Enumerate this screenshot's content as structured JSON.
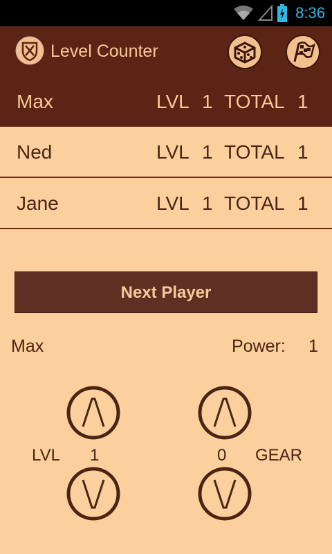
{
  "status_bar": {
    "time": "8:36",
    "icons": [
      "wifi-icon",
      "signal-icon",
      "battery-charging-icon"
    ]
  },
  "app": {
    "title": "Level Counter",
    "icon": "shield-swords-icon"
  },
  "action_bar": {
    "buttons": [
      "dice-icon",
      "checkered-flag-icon"
    ]
  },
  "players": [
    {
      "name": "Max",
      "lvl_label": "LVL",
      "lvl": "1",
      "total_label": "TOTAL",
      "total": "1",
      "selected": true
    },
    {
      "name": "Ned",
      "lvl_label": "LVL",
      "lvl": "1",
      "total_label": "TOTAL",
      "total": "1",
      "selected": false
    },
    {
      "name": "Jane",
      "lvl_label": "LVL",
      "lvl": "1",
      "total_label": "TOTAL",
      "total": "1",
      "selected": false
    }
  ],
  "next_button": {
    "label": "Next Player"
  },
  "current": {
    "name": "Max",
    "power_label": "Power:",
    "power": "1",
    "lvl_label": "LVL",
    "lvl": "1",
    "gear": "0",
    "gear_label": "GEAR"
  },
  "colors": {
    "background": "#fcd09c",
    "dark": "#5b2414",
    "accent_text": "#f7c99a",
    "clock": "#33b5e5"
  }
}
